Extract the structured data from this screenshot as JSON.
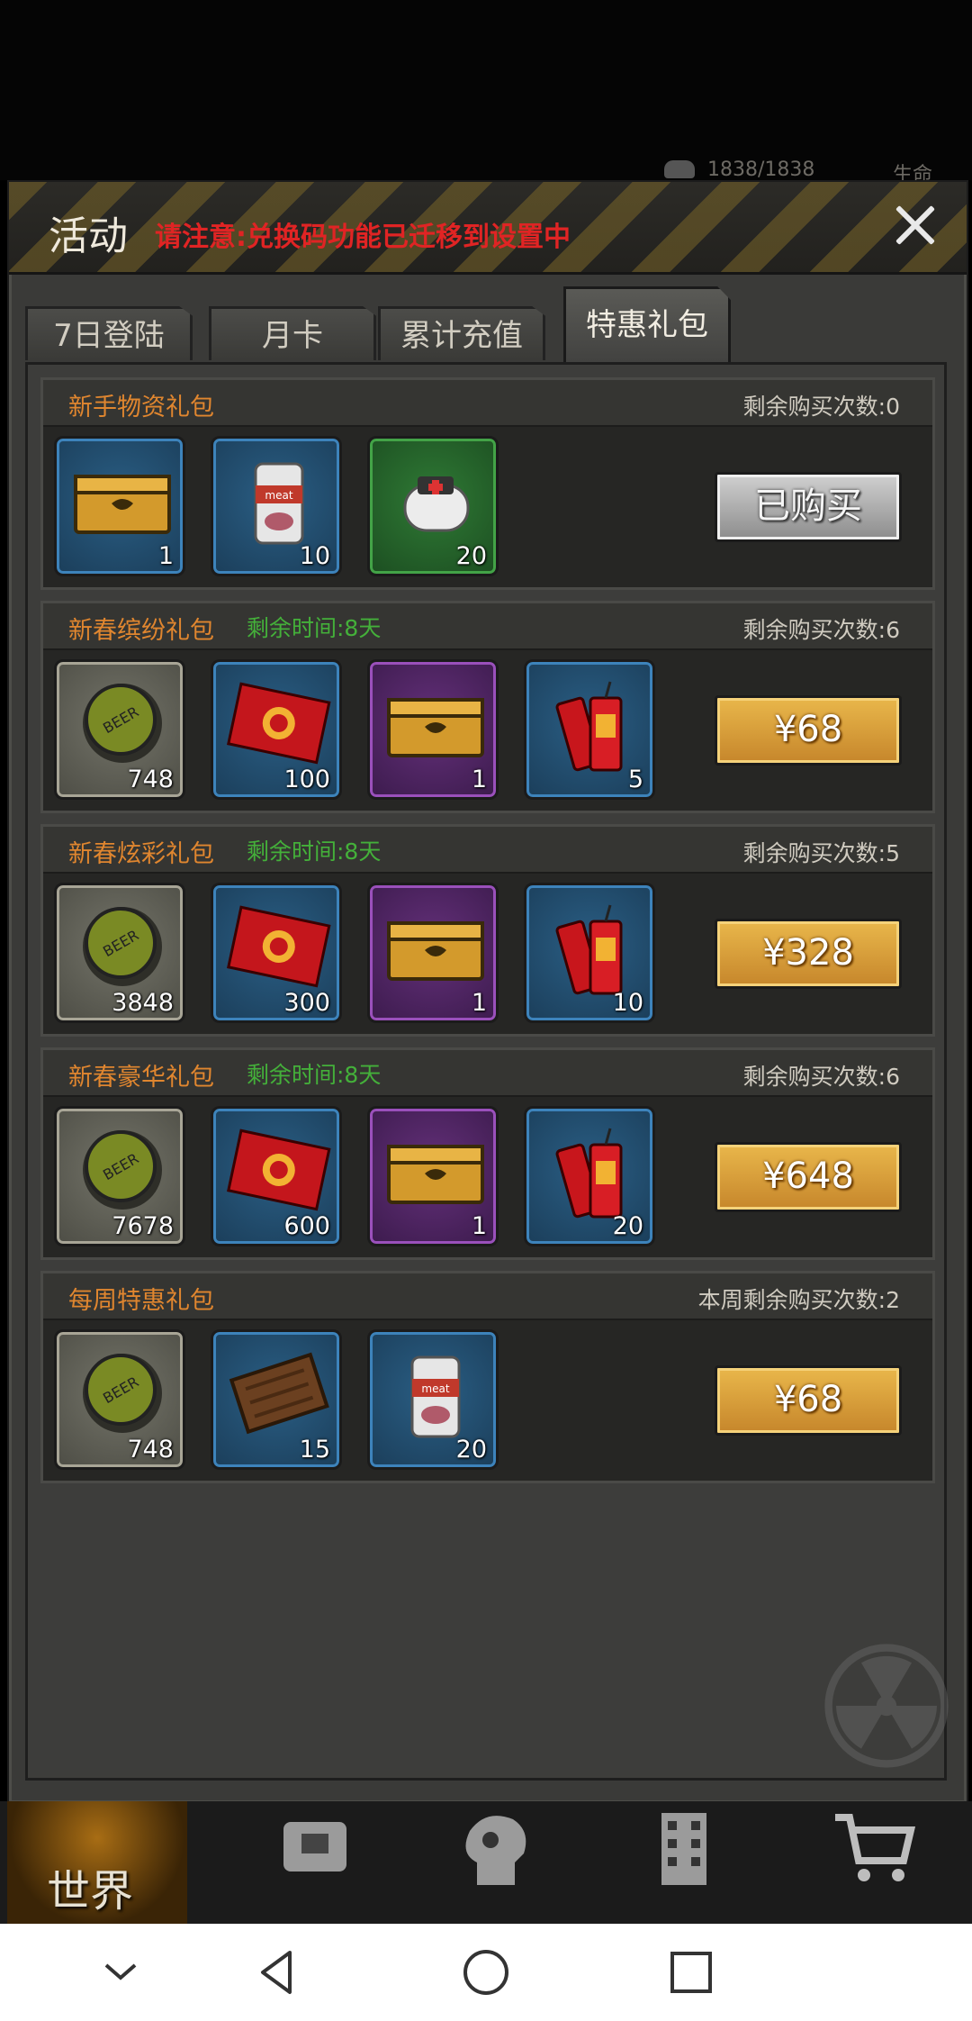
{
  "status": {
    "hp_text": "1838/1838",
    "life_text": "生命"
  },
  "header": {
    "title": "活动",
    "notice": "请注意:兑换码功能已迁移到设置中",
    "close_icon": "close-icon"
  },
  "tabs": [
    {
      "label": "7日登陆",
      "active": false
    },
    {
      "label": "月卡",
      "active": false
    },
    {
      "label": "累计充值",
      "active": false
    },
    {
      "label": "特惠礼包",
      "active": true
    }
  ],
  "packs": [
    {
      "name": "新手物资礼包",
      "timer": "",
      "remain": "剩余购买次数:0",
      "button": "已购买",
      "items": [
        {
          "icon": "crate-icon",
          "rarity": "blue",
          "count": "1"
        },
        {
          "icon": "meat-can-icon",
          "rarity": "blue",
          "count": "10"
        },
        {
          "icon": "bandage-icon",
          "rarity": "green",
          "count": "20"
        }
      ]
    },
    {
      "name": "新春缤纷礼包",
      "timer": "剩余时间:8天",
      "remain": "剩余购买次数:6",
      "button": "¥68",
      "items": [
        {
          "icon": "bottle-cap-icon",
          "rarity": "grey",
          "count": "748"
        },
        {
          "icon": "red-envelope-icon",
          "rarity": "blue",
          "count": "100"
        },
        {
          "icon": "crate-icon",
          "rarity": "purple",
          "count": "1"
        },
        {
          "icon": "firecracker-icon",
          "rarity": "blue",
          "count": "5"
        }
      ]
    },
    {
      "name": "新春炫彩礼包",
      "timer": "剩余时间:8天",
      "remain": "剩余购买次数:5",
      "button": "¥328",
      "items": [
        {
          "icon": "bottle-cap-icon",
          "rarity": "grey",
          "count": "3848"
        },
        {
          "icon": "red-envelope-icon",
          "rarity": "blue",
          "count": "300"
        },
        {
          "icon": "crate-icon",
          "rarity": "purple",
          "count": "1"
        },
        {
          "icon": "firecracker-icon",
          "rarity": "blue",
          "count": "10"
        }
      ]
    },
    {
      "name": "新春豪华礼包",
      "timer": "剩余时间:8天",
      "remain": "剩余购买次数:6",
      "button": "¥648",
      "items": [
        {
          "icon": "bottle-cap-icon",
          "rarity": "grey",
          "count": "7678"
        },
        {
          "icon": "red-envelope-icon",
          "rarity": "blue",
          "count": "600"
        },
        {
          "icon": "crate-icon",
          "rarity": "purple",
          "count": "1"
        },
        {
          "icon": "firecracker-icon",
          "rarity": "blue",
          "count": "20"
        }
      ]
    },
    {
      "name": "每周特惠礼包",
      "timer": "",
      "remain": "本周剩余购买次数:2",
      "button": "¥68",
      "items": [
        {
          "icon": "bottle-cap-icon",
          "rarity": "grey",
          "count": "748"
        },
        {
          "icon": "wood-board-icon",
          "rarity": "blue",
          "count": "15"
        },
        {
          "icon": "meat-can-icon",
          "rarity": "blue",
          "count": "20"
        }
      ]
    }
  ],
  "bottom_nav": {
    "world_label": "世界"
  },
  "colors": {
    "accent_gold": "#e9b74b",
    "notice_red": "#e02424",
    "timer_green": "#44b03a",
    "pack_name_orange": "#e0862f"
  }
}
